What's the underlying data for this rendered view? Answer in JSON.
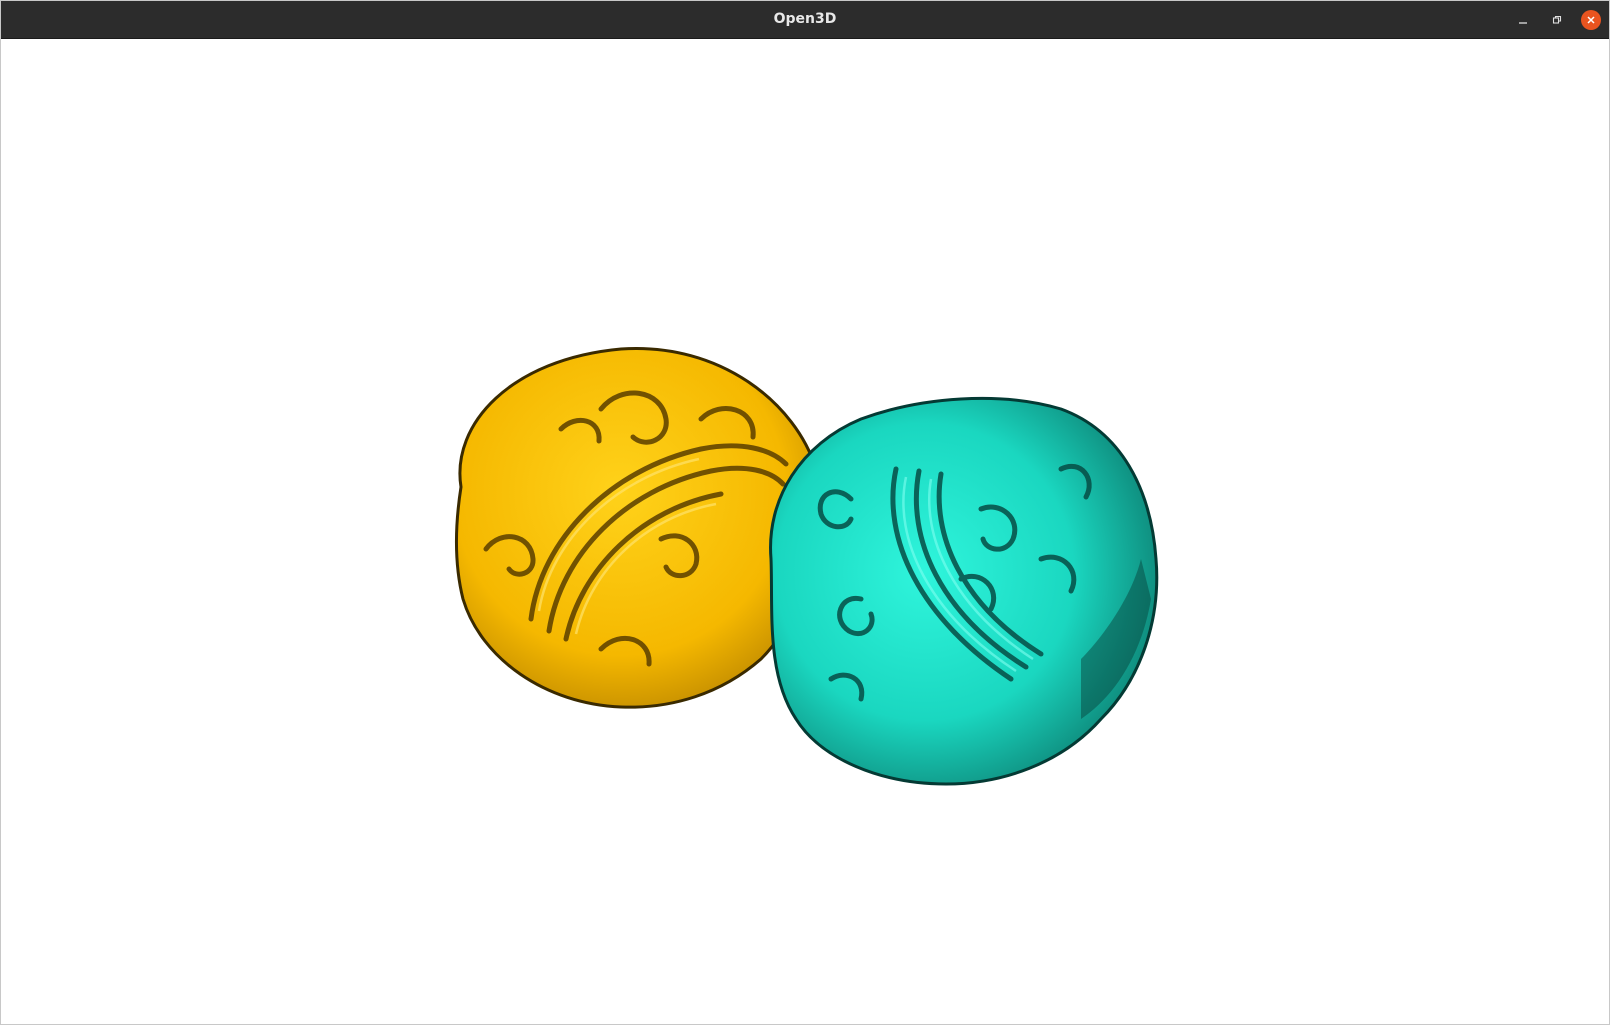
{
  "window": {
    "title": "Open3D",
    "controls": {
      "minimize_icon": "minimize-icon",
      "maximize_icon": "restore-icon",
      "close_icon": "close-icon"
    },
    "close_color": "#e95420",
    "titlebar_color": "#2c2c2c"
  },
  "scene": {
    "background": "#ffffff",
    "objects": [
      {
        "name": "coin-yellow",
        "color": "#ffc400"
      },
      {
        "name": "coin-cyan",
        "color": "#19e0c8"
      }
    ]
  }
}
